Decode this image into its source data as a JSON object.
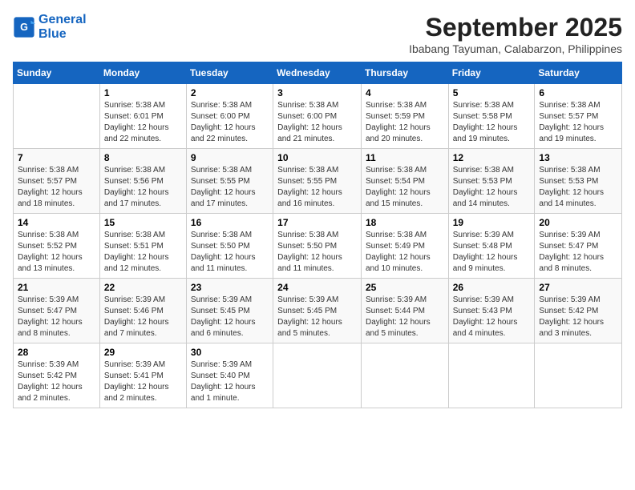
{
  "logo": {
    "line1": "General",
    "line2": "Blue"
  },
  "title": "September 2025",
  "subtitle": "Ibabang Tayuman, Calabarzon, Philippines",
  "columns": [
    "Sunday",
    "Monday",
    "Tuesday",
    "Wednesday",
    "Thursday",
    "Friday",
    "Saturday"
  ],
  "weeks": [
    [
      {
        "day": "",
        "info": ""
      },
      {
        "day": "1",
        "info": "Sunrise: 5:38 AM\nSunset: 6:01 PM\nDaylight: 12 hours\nand 22 minutes."
      },
      {
        "day": "2",
        "info": "Sunrise: 5:38 AM\nSunset: 6:00 PM\nDaylight: 12 hours\nand 22 minutes."
      },
      {
        "day": "3",
        "info": "Sunrise: 5:38 AM\nSunset: 6:00 PM\nDaylight: 12 hours\nand 21 minutes."
      },
      {
        "day": "4",
        "info": "Sunrise: 5:38 AM\nSunset: 5:59 PM\nDaylight: 12 hours\nand 20 minutes."
      },
      {
        "day": "5",
        "info": "Sunrise: 5:38 AM\nSunset: 5:58 PM\nDaylight: 12 hours\nand 19 minutes."
      },
      {
        "day": "6",
        "info": "Sunrise: 5:38 AM\nSunset: 5:57 PM\nDaylight: 12 hours\nand 19 minutes."
      }
    ],
    [
      {
        "day": "7",
        "info": "Sunrise: 5:38 AM\nSunset: 5:57 PM\nDaylight: 12 hours\nand 18 minutes."
      },
      {
        "day": "8",
        "info": "Sunrise: 5:38 AM\nSunset: 5:56 PM\nDaylight: 12 hours\nand 17 minutes."
      },
      {
        "day": "9",
        "info": "Sunrise: 5:38 AM\nSunset: 5:55 PM\nDaylight: 12 hours\nand 17 minutes."
      },
      {
        "day": "10",
        "info": "Sunrise: 5:38 AM\nSunset: 5:55 PM\nDaylight: 12 hours\nand 16 minutes."
      },
      {
        "day": "11",
        "info": "Sunrise: 5:38 AM\nSunset: 5:54 PM\nDaylight: 12 hours\nand 15 minutes."
      },
      {
        "day": "12",
        "info": "Sunrise: 5:38 AM\nSunset: 5:53 PM\nDaylight: 12 hours\nand 14 minutes."
      },
      {
        "day": "13",
        "info": "Sunrise: 5:38 AM\nSunset: 5:53 PM\nDaylight: 12 hours\nand 14 minutes."
      }
    ],
    [
      {
        "day": "14",
        "info": "Sunrise: 5:38 AM\nSunset: 5:52 PM\nDaylight: 12 hours\nand 13 minutes."
      },
      {
        "day": "15",
        "info": "Sunrise: 5:38 AM\nSunset: 5:51 PM\nDaylight: 12 hours\nand 12 minutes."
      },
      {
        "day": "16",
        "info": "Sunrise: 5:38 AM\nSunset: 5:50 PM\nDaylight: 12 hours\nand 11 minutes."
      },
      {
        "day": "17",
        "info": "Sunrise: 5:38 AM\nSunset: 5:50 PM\nDaylight: 12 hours\nand 11 minutes."
      },
      {
        "day": "18",
        "info": "Sunrise: 5:38 AM\nSunset: 5:49 PM\nDaylight: 12 hours\nand 10 minutes."
      },
      {
        "day": "19",
        "info": "Sunrise: 5:39 AM\nSunset: 5:48 PM\nDaylight: 12 hours\nand 9 minutes."
      },
      {
        "day": "20",
        "info": "Sunrise: 5:39 AM\nSunset: 5:47 PM\nDaylight: 12 hours\nand 8 minutes."
      }
    ],
    [
      {
        "day": "21",
        "info": "Sunrise: 5:39 AM\nSunset: 5:47 PM\nDaylight: 12 hours\nand 8 minutes."
      },
      {
        "day": "22",
        "info": "Sunrise: 5:39 AM\nSunset: 5:46 PM\nDaylight: 12 hours\nand 7 minutes."
      },
      {
        "day": "23",
        "info": "Sunrise: 5:39 AM\nSunset: 5:45 PM\nDaylight: 12 hours\nand 6 minutes."
      },
      {
        "day": "24",
        "info": "Sunrise: 5:39 AM\nSunset: 5:45 PM\nDaylight: 12 hours\nand 5 minutes."
      },
      {
        "day": "25",
        "info": "Sunrise: 5:39 AM\nSunset: 5:44 PM\nDaylight: 12 hours\nand 5 minutes."
      },
      {
        "day": "26",
        "info": "Sunrise: 5:39 AM\nSunset: 5:43 PM\nDaylight: 12 hours\nand 4 minutes."
      },
      {
        "day": "27",
        "info": "Sunrise: 5:39 AM\nSunset: 5:42 PM\nDaylight: 12 hours\nand 3 minutes."
      }
    ],
    [
      {
        "day": "28",
        "info": "Sunrise: 5:39 AM\nSunset: 5:42 PM\nDaylight: 12 hours\nand 2 minutes."
      },
      {
        "day": "29",
        "info": "Sunrise: 5:39 AM\nSunset: 5:41 PM\nDaylight: 12 hours\nand 2 minutes."
      },
      {
        "day": "30",
        "info": "Sunrise: 5:39 AM\nSunset: 5:40 PM\nDaylight: 12 hours\nand 1 minute."
      },
      {
        "day": "",
        "info": ""
      },
      {
        "day": "",
        "info": ""
      },
      {
        "day": "",
        "info": ""
      },
      {
        "day": "",
        "info": ""
      }
    ]
  ]
}
